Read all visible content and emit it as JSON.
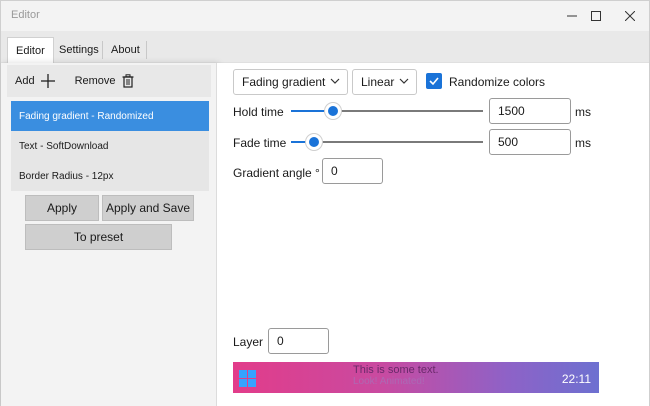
{
  "window": {
    "title": "Editor",
    "controls": {
      "minimize_icon": "minimize-icon",
      "maximize_icon": "maximize-icon",
      "close_icon": "close-icon"
    }
  },
  "tabs": [
    {
      "label": "Editor",
      "active": true
    },
    {
      "label": "Settings",
      "active": false
    },
    {
      "label": "About",
      "active": false
    }
  ],
  "sidebar": {
    "add_label": "Add",
    "remove_label": "Remove",
    "items": [
      {
        "label": "Fading gradient - Randomized",
        "selected": true
      },
      {
        "label": "Text - SoftDownload",
        "selected": false
      },
      {
        "label": "Border Radius - 12px",
        "selected": false
      }
    ],
    "apply_label": "Apply",
    "apply_save_label": "Apply and Save",
    "to_preset_label": "To preset"
  },
  "editor": {
    "effect_select": "Fading gradient",
    "interp_select": "Linear",
    "randomize_label": "Randomize colors",
    "randomize_checked": true,
    "hold_time_label": "Hold time",
    "hold_time_value": "1500",
    "hold_time_unit": "ms",
    "hold_time_slider": 0.22,
    "fade_time_label": "Fade time",
    "fade_time_value": "500",
    "fade_time_unit": "ms",
    "fade_time_slider": 0.12,
    "gradient_angle_label": "Gradient angle °",
    "gradient_angle_value": "0",
    "layer_label": "Layer",
    "layer_value": "0"
  },
  "preview": {
    "text_line1": "This is some text.",
    "text_line2": "Look! Animated!",
    "clock": "22:11"
  },
  "colors": {
    "accent": "#1a73d8",
    "selected_item": "#3a8ee0",
    "gradient_start": "#e23c8a",
    "gradient_end": "#6d70d0"
  }
}
